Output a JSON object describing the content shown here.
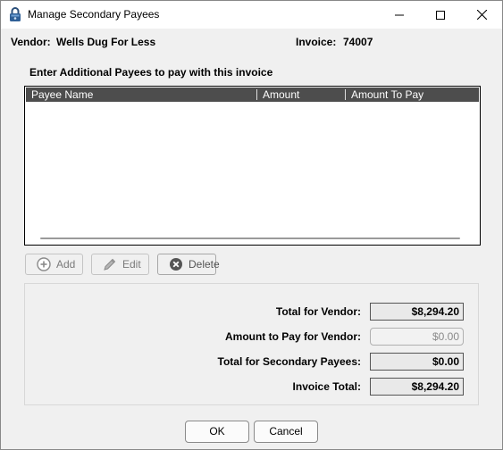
{
  "window": {
    "title": "Manage Secondary Payees",
    "controls": [
      "minimize-icon",
      "maximize-icon",
      "close-icon"
    ]
  },
  "header": {
    "vendor_label": "Vendor:",
    "vendor_value": "Wells Dug For Less",
    "invoice_label": "Invoice:",
    "invoice_value": "74007"
  },
  "instructions": "Enter Additional Payees to pay with this invoice",
  "payees_table": {
    "columns": [
      "Payee Name",
      "Amount",
      "Amount To Pay"
    ],
    "rows": []
  },
  "actions": {
    "add_label": "Add",
    "edit_label": "Edit",
    "delete_label": "Delete"
  },
  "summary": {
    "total_for_vendor_label": "Total for Vendor:",
    "total_for_vendor_value": "$8,294.20",
    "amount_to_pay_label": "Amount to Pay for Vendor:",
    "amount_to_pay_value": "$0.00",
    "total_secondary_label": "Total for Secondary Payees:",
    "total_secondary_value": "$0.00",
    "invoice_total_label": "Invoice Total:",
    "invoice_total_value": "$8,294.20"
  },
  "dialog_buttons": {
    "ok_label": "OK",
    "cancel_label": "Cancel"
  }
}
